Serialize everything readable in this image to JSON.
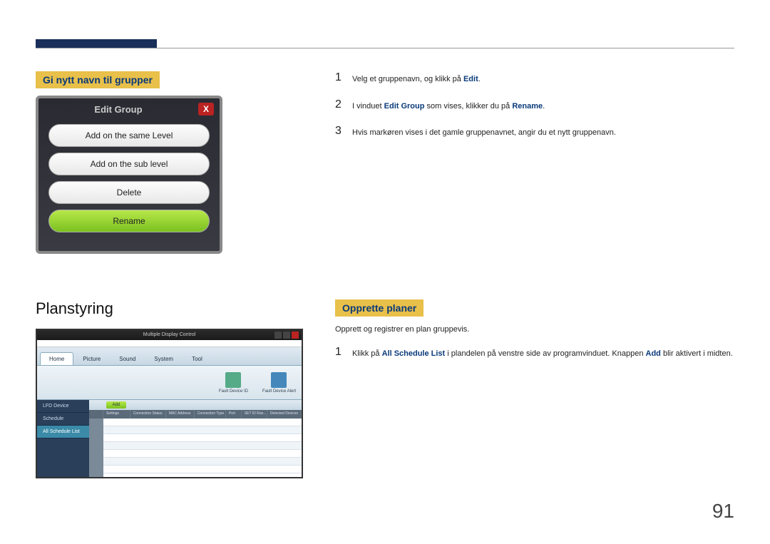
{
  "section1": {
    "heading": "Gi nytt navn til grupper",
    "dialog": {
      "title": "Edit Group",
      "close": "X",
      "options": [
        "Add on the same Level",
        "Add on the sub level",
        "Delete",
        "Rename"
      ]
    }
  },
  "steps1": [
    {
      "num": "1",
      "parts": [
        "Velg et gruppenavn, og klikk på ",
        "Edit",
        "."
      ]
    },
    {
      "num": "2",
      "parts": [
        "I vinduet ",
        "Edit Group",
        " som vises, klikker du på ",
        "Rename",
        "."
      ]
    },
    {
      "num": "3",
      "parts": [
        "Hvis markøren vises i det gamle gruppenavnet, angir du et nytt gruppenavn."
      ]
    }
  ],
  "section2": {
    "heading": "Planstyring",
    "screenshot": {
      "title": "Multiple Display Control",
      "tabs": [
        "Home",
        "Picture",
        "Sound",
        "System",
        "Tool"
      ],
      "ribbon_labels": [
        "Fault Device ID",
        "Fault Device Alert"
      ],
      "sidebar": [
        "LFD Device",
        "Schedule",
        "All Schedule List"
      ],
      "add_label": "Add",
      "columns": [
        "Settings",
        "Connection Status",
        "MAC Address",
        "Connection Type",
        "Port",
        "SET ID Ran...",
        "Detected Devices"
      ]
    }
  },
  "section3": {
    "heading": "Opprette planer",
    "intro": "Opprett og registrer en plan gruppevis.",
    "steps": [
      {
        "num": "1",
        "parts": [
          "Klikk på ",
          "All Schedule List",
          " i plandelen på venstre side av programvinduet. Knappen ",
          "Add",
          " blir aktivert i midten."
        ]
      }
    ]
  },
  "page_number": "91"
}
